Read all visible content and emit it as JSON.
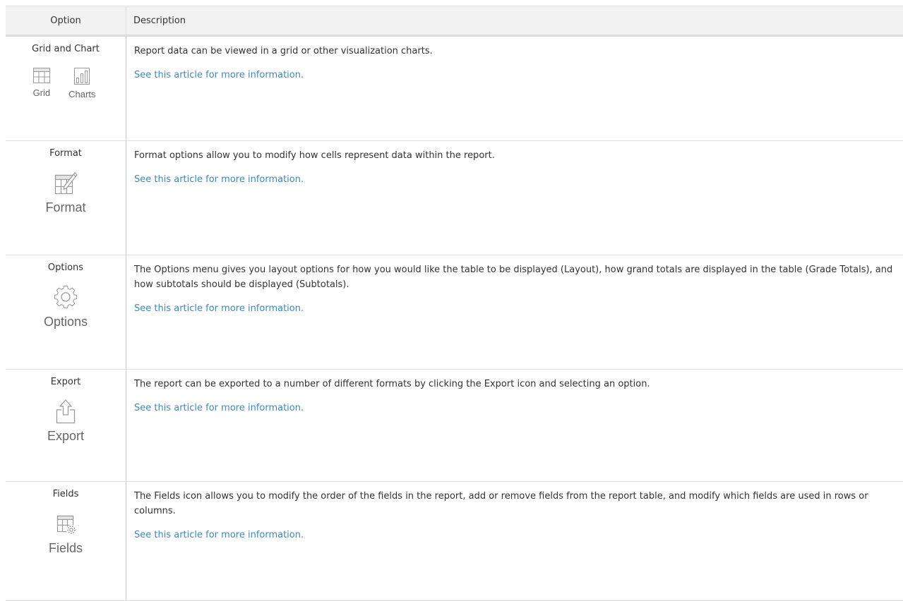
{
  "table": {
    "headers": {
      "option": "Option",
      "description": "Description"
    },
    "rows": [
      {
        "option": "Grid and Chart",
        "icon_labels": [
          "Grid",
          "Charts"
        ],
        "icons": [
          "grid-icon",
          "charts-icon"
        ],
        "description": "Report data can be viewed in a grid or other visualization charts.",
        "link": "See this article for more information."
      },
      {
        "option": "Format",
        "icon_label": "Format",
        "icon": "format-icon",
        "description": "Format options allow you to modify how cells represent data within the report.",
        "link": "See this article for more information."
      },
      {
        "option": "Options",
        "icon_label": "Options",
        "icon": "gear-icon",
        "description": "The Options menu gives you layout options for how you would like the table to be displayed (Layout), how grand totals are displayed in the table (Grade Totals), and how subtotals should be displayed (Subtotals).",
        "link": "See this article for more information."
      },
      {
        "option": "Export",
        "icon_label": "Export",
        "icon": "export-icon",
        "description": "The report can be exported to a number of different formats by clicking the Export icon and selecting an option.",
        "link": "See this article for more information."
      },
      {
        "option": "Fields",
        "icon_label": "Fields",
        "icon": "fields-icon",
        "description": "The Fields icon allows you to modify the order of the fields in the report, add or remove fields from the report table, and modify which fields are used in rows or columns.",
        "link": "See this article for more information."
      }
    ]
  },
  "colors": {
    "link": "#3b8ac7",
    "header_bg": "#f2f2f2",
    "icon_stroke": "#9a9a9a",
    "text": "#333333"
  }
}
